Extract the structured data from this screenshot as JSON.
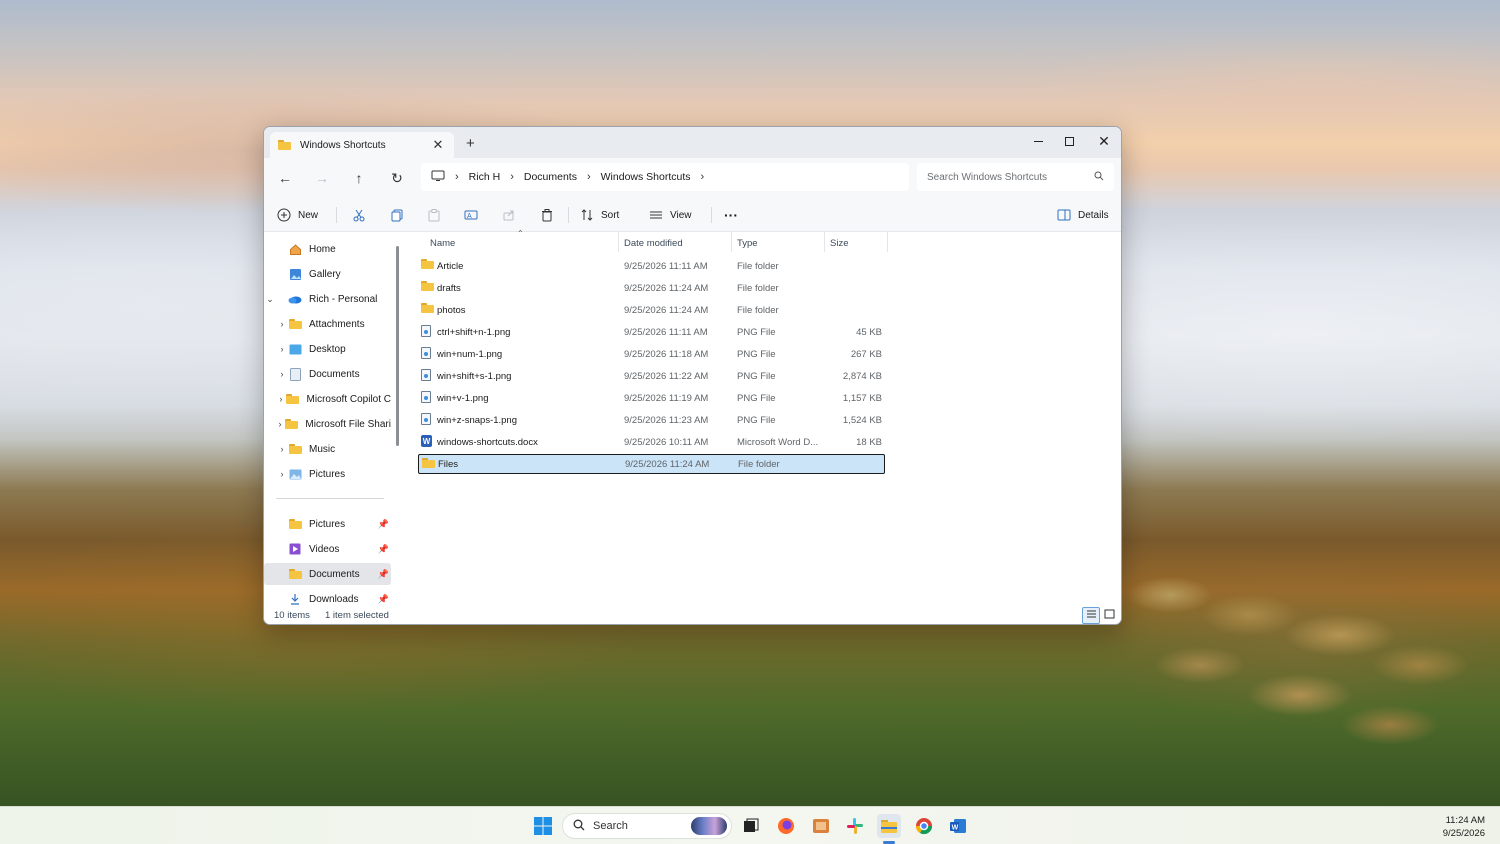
{
  "window": {
    "tab_title": "Windows Shortcuts",
    "tab_close": "✕",
    "new_tab": "+",
    "minimize": "—",
    "close": "✕"
  },
  "navigation": {
    "back": "←",
    "forward": "→",
    "up": "↑",
    "refresh": "↻",
    "breadcrumb": [
      "Rich H",
      "Documents",
      "Windows Shortcuts"
    ],
    "search_placeholder": "Search Windows Shortcuts"
  },
  "commands": {
    "new": "New",
    "sort": "Sort",
    "view": "View",
    "more": "···",
    "details": "Details"
  },
  "sidebar": {
    "top": [
      {
        "label": "Home",
        "icon": "home-icon"
      },
      {
        "label": "Gallery",
        "icon": "gallery-icon"
      },
      {
        "label": "Rich - Personal",
        "icon": "onedrive-icon",
        "expanded": true
      }
    ],
    "onedrive_children": [
      {
        "label": "Attachments"
      },
      {
        "label": "Desktop"
      },
      {
        "label": "Documents"
      },
      {
        "label": "Microsoft Copilot C"
      },
      {
        "label": "Microsoft File Shari"
      },
      {
        "label": "Music"
      },
      {
        "label": "Pictures"
      }
    ],
    "quick_access": [
      {
        "label": "Pictures",
        "icon": "folder-icon"
      },
      {
        "label": "Videos",
        "icon": "videos-icon"
      },
      {
        "label": "Documents",
        "icon": "folder-icon",
        "selected": true
      },
      {
        "label": "Downloads",
        "icon": "download-icon"
      }
    ]
  },
  "file_list": {
    "columns": [
      "Name",
      "Date modified",
      "Type",
      "Size"
    ],
    "rows": [
      {
        "name": "Article",
        "date": "9/25/2026 11:11 AM",
        "type": "File folder",
        "size": "",
        "kind": "folder"
      },
      {
        "name": "drafts",
        "date": "9/25/2026 11:24 AM",
        "type": "File folder",
        "size": "",
        "kind": "folder"
      },
      {
        "name": "photos",
        "date": "9/25/2026 11:24 AM",
        "type": "File folder",
        "size": "",
        "kind": "folder"
      },
      {
        "name": "ctrl+shift+n-1.png",
        "date": "9/25/2026 11:11 AM",
        "type": "PNG File",
        "size": "45 KB",
        "kind": "png"
      },
      {
        "name": "win+num-1.png",
        "date": "9/25/2026 11:18 AM",
        "type": "PNG File",
        "size": "267 KB",
        "kind": "png"
      },
      {
        "name": "win+shift+s-1.png",
        "date": "9/25/2026 11:22 AM",
        "type": "PNG File",
        "size": "2,874 KB",
        "kind": "png"
      },
      {
        "name": "win+v-1.png",
        "date": "9/25/2026 11:19 AM",
        "type": "PNG File",
        "size": "1,157 KB",
        "kind": "png"
      },
      {
        "name": "win+z-snaps-1.png",
        "date": "9/25/2026 11:23 AM",
        "type": "PNG File",
        "size": "1,524 KB",
        "kind": "png"
      },
      {
        "name": "windows-shortcuts.docx",
        "date": "9/25/2026 10:11 AM",
        "type": "Microsoft Word D...",
        "size": "18 KB",
        "kind": "docx"
      },
      {
        "name": "Files",
        "date": "9/25/2026 11:24 AM",
        "type": "File folder",
        "size": "",
        "kind": "folder",
        "selected": true
      }
    ]
  },
  "status": {
    "item_count": "10 items",
    "selection": "1 item selected"
  },
  "taskbar": {
    "search_label": "Search",
    "time": "11:24 AM",
    "date": "9/25/2026"
  },
  "colors": {
    "selection_bg": "#cce4f7",
    "folder_yellow": "#f5c542",
    "accent": "#3a7bd5"
  }
}
